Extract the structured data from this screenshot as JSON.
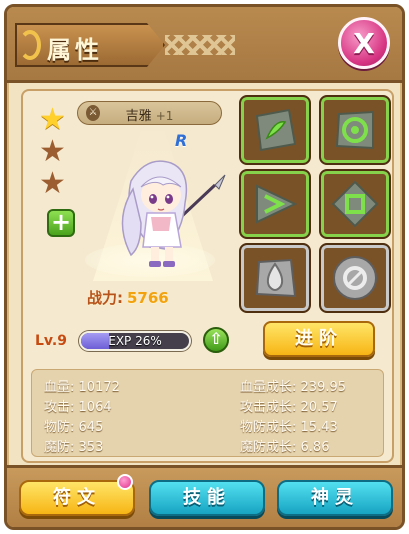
{
  "header": {
    "title": "属性"
  },
  "close_label": "X",
  "hero": {
    "name": "吉雅",
    "enhance": "+1",
    "rank_badge": "R",
    "stars_lit": 1,
    "stars_total": 3,
    "power_label": "战力:",
    "power_value": "5766",
    "level": "Lv.9",
    "exp_text": "EXP 26%",
    "exp_fraction": 0.26
  },
  "buttons": {
    "advance": "进阶",
    "add": "+",
    "level_up": "⇧"
  },
  "runes": [
    {
      "name": "rune-slot-1",
      "style": "green",
      "icon": "leaf-rune-icon"
    },
    {
      "name": "rune-slot-2",
      "style": "green",
      "icon": "spiral-rune-icon"
    },
    {
      "name": "rune-slot-3",
      "style": "green",
      "icon": "arrow-rune-icon"
    },
    {
      "name": "rune-slot-4",
      "style": "green",
      "icon": "square-rune-icon"
    },
    {
      "name": "rune-slot-5",
      "style": "silver",
      "icon": "drop-rune-icon"
    },
    {
      "name": "rune-slot-6",
      "style": "silver",
      "icon": "circle-rune-icon"
    }
  ],
  "stats": {
    "left": [
      {
        "label": "血量",
        "value": "10172"
      },
      {
        "label": "攻击",
        "value": "1064"
      },
      {
        "label": "物防",
        "value": "645"
      },
      {
        "label": "魔防",
        "value": "353"
      }
    ],
    "right": [
      {
        "label": "血量成长",
        "value": "239.95"
      },
      {
        "label": "攻击成长",
        "value": "20.57"
      },
      {
        "label": "物防成长",
        "value": "15.43"
      },
      {
        "label": "魔防成长",
        "value": "6.86"
      }
    ]
  },
  "tabs": [
    {
      "label": "符文",
      "style": "yellow",
      "has_notification": true
    },
    {
      "label": "技能",
      "style": "teal"
    },
    {
      "label": "神灵",
      "style": "teal"
    }
  ],
  "colors": {
    "panel_bg": "#f2e4c2",
    "frame": "#7a5228",
    "accent_yellow": "#f7b515",
    "accent_teal": "#17a4c2",
    "close_pink": "#d73583"
  }
}
